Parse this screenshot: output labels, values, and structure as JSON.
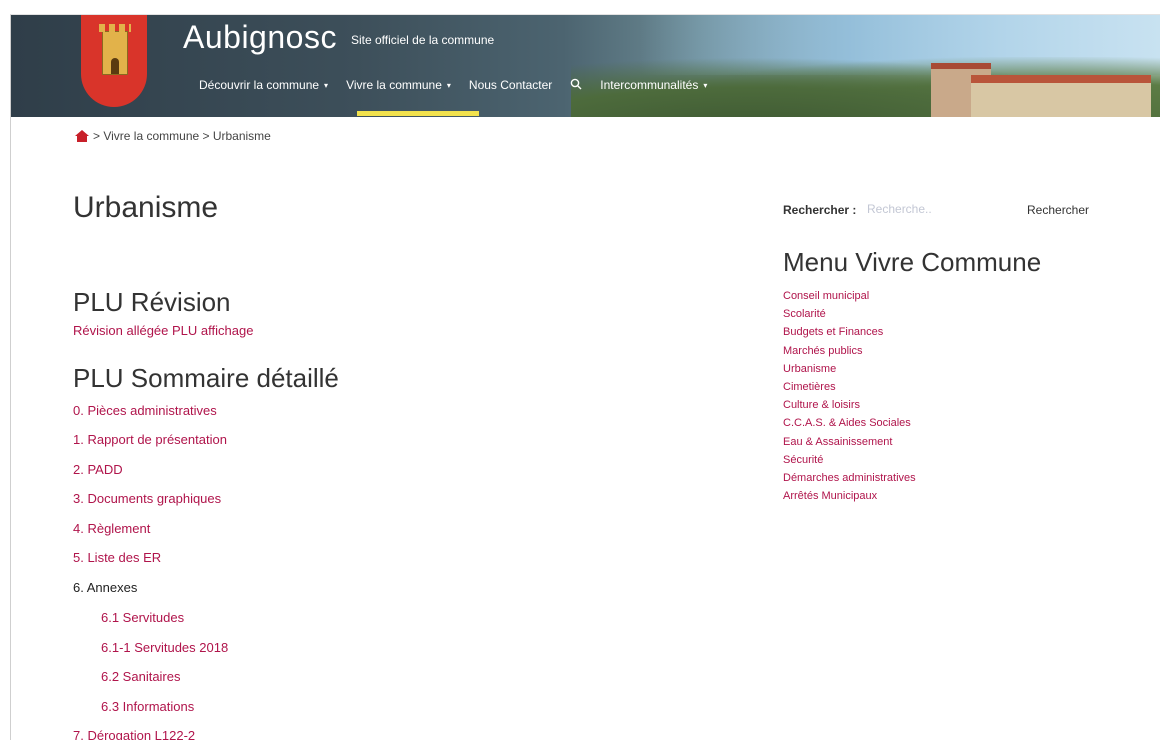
{
  "header": {
    "site_name": "Aubignosc",
    "tagline": "Site officiel de la commune",
    "nav": [
      {
        "label": "Découvrir la commune",
        "caret": "▾"
      },
      {
        "label": "Vivre la commune",
        "caret": "▾"
      },
      {
        "label": "Nous Contacter",
        "caret": ""
      },
      {
        "label": "Intercommunalités",
        "caret": "▾"
      }
    ],
    "search_icon": "search-icon"
  },
  "breadcrumb": {
    "home_icon": "home-icon",
    "text": "> Vivre la commune > Urbanisme"
  },
  "main": {
    "title": "Urbanisme",
    "section1_title": "PLU Révision",
    "section1_link": "Révision allégée PLU affichage",
    "section2_title": "PLU Sommaire détaillé",
    "items": [
      "0. Pièces administratives",
      "1. Rapport de présentation",
      "2. PADD",
      "3. Documents graphiques",
      "4. Règlement",
      "5. Liste des ER",
      "6. Annexes",
      "6.1 Servitudes",
      "6.1-1 Servitudes 2018",
      "6.2 Sanitaires",
      "6.3 Informations",
      "7. Dérogation L122-2"
    ]
  },
  "sidebar": {
    "search_label": "Rechercher :",
    "search_placeholder": "Recherche..",
    "search_button": "Rechercher",
    "menu_title": "Menu Vivre Commune",
    "menu": [
      "Conseil municipal",
      "Scolarité",
      "Budgets et Finances",
      "Marchés publics",
      "Urbanisme",
      "Cimetières",
      "Culture & loisirs",
      "C.C.A.S. & Aides Sociales",
      "Eau & Assainissement",
      "Sécurité",
      "Démarches administratives",
      "Arrêtés Municipaux"
    ]
  },
  "colors": {
    "link": "#b0144b",
    "active_nav_bar": "#f2e24d",
    "crest": "#d9342a"
  }
}
